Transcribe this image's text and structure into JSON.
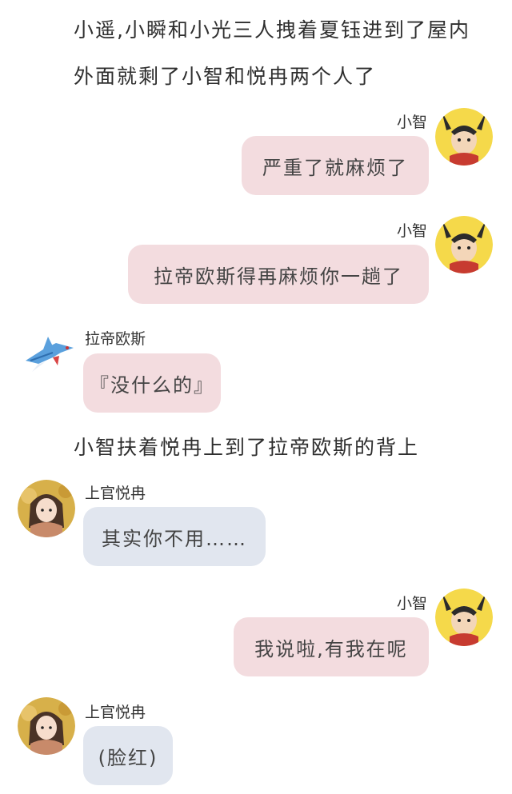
{
  "narration": [
    "小遥,小瞬和小光三人拽着夏钰进到了屋内",
    "外面就剩了小智和悦冉两个人了",
    "小智扶着悦冉上到了拉帝欧斯的背上"
  ],
  "messages": [
    {
      "speaker": "小智",
      "text": "严重了就麻烦了",
      "avatar": "pikachu-hood-avatar-icon"
    },
    {
      "speaker": "小智",
      "text": "拉帝欧斯得再麻烦你一趟了",
      "avatar": "pikachu-hood-avatar-icon"
    },
    {
      "speaker": "拉帝欧斯",
      "text": "『没什么的』",
      "avatar": "latios-avatar-icon"
    },
    {
      "speaker": "上官悦冉",
      "text": "其实你不用……",
      "avatar": "girl-avatar-icon"
    },
    {
      "speaker": "小智",
      "text": "我说啦,有我在呢",
      "avatar": "pikachu-hood-avatar-icon"
    },
    {
      "speaker": "上官悦冉",
      "text": "(脸红)",
      "avatar": "girl-avatar-icon"
    }
  ],
  "colors": {
    "right_bubble": "#f3dcdf",
    "left_bubble": "#e1e6ef",
    "pikachu_yellow": "#f5d94a"
  }
}
